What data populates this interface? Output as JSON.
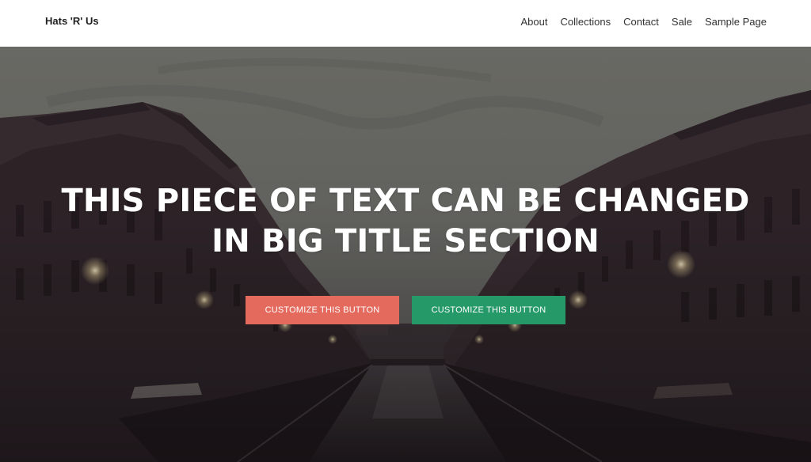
{
  "header": {
    "site_title": "Hats 'R' Us",
    "nav": [
      {
        "label": "About"
      },
      {
        "label": "Collections"
      },
      {
        "label": "Contact"
      },
      {
        "label": "Sale"
      },
      {
        "label": "Sample Page"
      }
    ]
  },
  "hero": {
    "title_line1": "THIS PIECE OF TEXT CAN BE CHANGED",
    "title_line2": "IN BIG TITLE SECTION",
    "buttons": [
      {
        "label": "CUSTOMIZE THIS BUTTON",
        "color": "#e46a5e"
      },
      {
        "label": "CUSTOMIZE THIS BUTTON",
        "color": "#259968"
      }
    ]
  }
}
